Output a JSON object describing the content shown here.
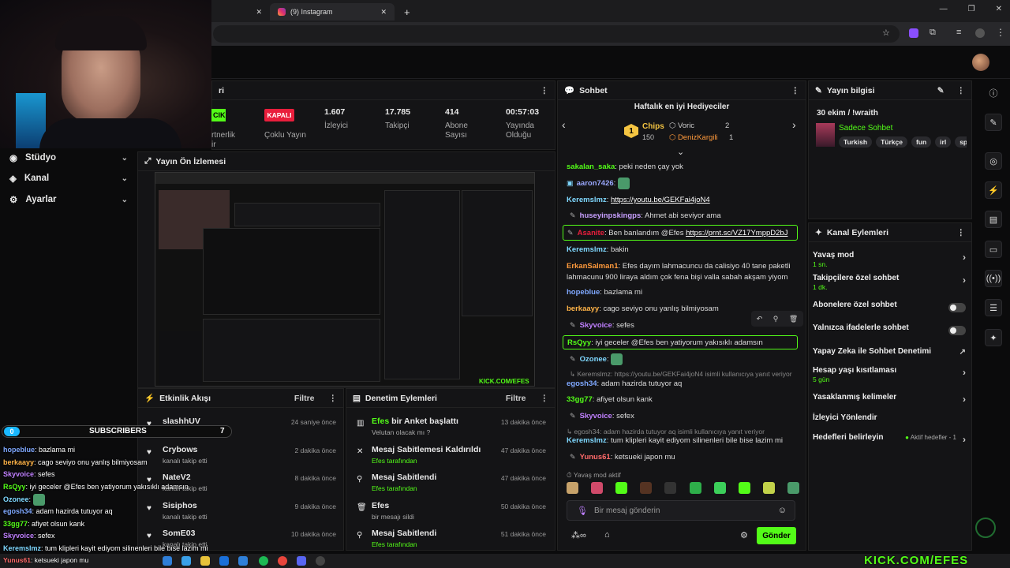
{
  "browser": {
    "tab_instagram": "(9) Instagram",
    "new_tab": "+",
    "window_controls": [
      "—",
      "❐",
      "✕"
    ]
  },
  "colors": {
    "accent": "#53fc18",
    "danger": "#e91e3c",
    "bg": "#0b0b0c",
    "panel": "#141416"
  },
  "nav": {
    "items": [
      {
        "label": "Stüdyo",
        "icon": "studio-icon"
      },
      {
        "label": "Kanal",
        "icon": "channel-icon"
      },
      {
        "label": "Ayarlar",
        "icon": "gear-icon"
      }
    ]
  },
  "stats_panel": {
    "title_tail": "ri",
    "live_badge": "CIK",
    "live_sub": "rtnerlik\nir",
    "offline_badge": "KAPALI",
    "offline_label": "Çoklu Yayın",
    "stats": [
      {
        "value": "1.607",
        "label": "İzleyici"
      },
      {
        "value": "17.785",
        "label": "Takipçi"
      },
      {
        "value": "414",
        "label": "Abone Sayısı"
      },
      {
        "value": "00:57:03",
        "label": "Yayında Olduğu"
      }
    ]
  },
  "preview": {
    "title": "Yayın Ön İzlemesi",
    "watermark": "KICK.COM/EFES"
  },
  "activity": {
    "title": "Etkinlik Akışı",
    "filter": "Filtre",
    "rows": [
      {
        "name": "slashhUV",
        "sub": "kanalı takip etti",
        "time": "24 saniye önce"
      },
      {
        "name": "Crybows",
        "sub": "kanalı takip etti",
        "time": "2 dakika önce"
      },
      {
        "name": "NateV2",
        "sub": "kanalı takip etti",
        "time": "8 dakika önce"
      },
      {
        "name": "Sisiphos",
        "sub": "kanalı takip etti",
        "time": "9 dakika önce"
      },
      {
        "name": "SomE03",
        "sub": "kanalı takip etti",
        "time": "10 dakika önce"
      }
    ]
  },
  "moderation": {
    "title": "Denetim Eylemleri",
    "filter": "Filtre",
    "rows": [
      {
        "name": "Efes",
        "rest": "bir Anket başlattı",
        "sub": "Velutan olacak mı ?",
        "time": "13 dakika önce"
      },
      {
        "name": "Mesaj Sabitlemesi Kaldırıldı",
        "rest": "",
        "sub": "Efes tarafından",
        "time": "47 dakika önce"
      },
      {
        "name": "Mesaj Sabitlendi",
        "rest": "",
        "sub": "Efes tarafından",
        "time": "47 dakika önce"
      },
      {
        "name": "Efes",
        "rest": "",
        "sub": "bir mesajı sildi",
        "time": "50 dakika önce"
      },
      {
        "name": "Mesaj Sabitlendi",
        "rest": "",
        "sub": "Efes tarafından",
        "time": "51 dakika önce"
      }
    ]
  },
  "chat": {
    "title": "Sohbet",
    "gifters_title": "Haftalık en iyi Hediyeciler",
    "gifters": [
      {
        "rank": "1",
        "name": "Chips",
        "amount": "150"
      },
      {
        "name": "Voric",
        "amount": "2"
      },
      {
        "name": "DenizKargili",
        "amount": "1"
      }
    ],
    "messages": [
      {
        "user": "sakalan_saka",
        "text": ": peki neden çay yok",
        "color": "#53fc18"
      },
      {
        "user": "aaron7426",
        "text": ":",
        "color": "#9aa8ff"
      },
      {
        "user": "Keremslmz",
        "text": ": ",
        "link": "https://youtu.be/GEKFai4joN4",
        "color": "#7fd8ff"
      },
      {
        "user": "huseyinpskingps",
        "text": ": Ahmet abi seviyor ama",
        "color": "#c8a0ff"
      },
      {
        "user": "Asanite",
        "text": ": Ben banlandım @Efes ",
        "link": "https://prnt.sc/VZ17YmppD2bJ",
        "color": "#e91e3c"
      },
      {
        "user": "Keremslmz",
        "text": ": bakin",
        "color": "#7fd8ff"
      },
      {
        "user": "ErkanSalman1",
        "text": ": Efes dayım lahmacuncu da calisiyo 40 tane paketli",
        "color": "#ff9a3c"
      },
      {
        "user": "",
        "text": "lahmacunu 900 liraya aldım çok fena bişi valla sabah akşam yiyom",
        "color": "#ddd"
      },
      {
        "user": "hopeblue",
        "text": ": bazlama mi",
        "color": "#7fa8ff"
      },
      {
        "user": "berkaayy",
        "text": ": cago seviyo onu yanlış bilmiyosam",
        "color": "#ffb347"
      },
      {
        "user": "Skyvoice",
        "text": ": sefes",
        "color": "#c080ff"
      },
      {
        "user": "RsQyy",
        "text": ": iyi geceler @Efes ben yatiyorum yakısıklı adamsın",
        "color": "#53fc18"
      },
      {
        "user": "Ozonee",
        "text": ":",
        "color": "#7fd8ff"
      },
      {
        "user": "",
        "text": "Keremslmz: https://youtu.be/GEKFai4joN4 isimli kullanıcıya yanıt veriyor",
        "color": "#888"
      },
      {
        "user": "egosh34",
        "text": ": adam hazirda tutuyor aq",
        "color": "#7fa8ff"
      },
      {
        "user": "33gg77",
        "text": ": afiyet olsun kank",
        "color": "#53fc18"
      },
      {
        "user": "Skyvoice",
        "text": ": sefex",
        "color": "#c080ff"
      },
      {
        "user": "",
        "text": "egosh34: adam hazirda tutuyor aq isimli kullanıcıya yanıt veriyor",
        "color": "#888"
      },
      {
        "user": "Keremslmz",
        "text": ": tum klipleri kayit ediyom silinenleri bile bise lazim mi",
        "color": "#7fd8ff"
      },
      {
        "user": "Yunus61",
        "text": ": ketsueki japon mu",
        "color": "#ff6a6a"
      }
    ],
    "slow_mode": "Yavaş mod aktif",
    "input_placeholder": "Bir mesaj gönderin",
    "send": "Gönder"
  },
  "stream_info": {
    "title": "Yayın bilgisi",
    "stream_title": "30 ekim / !wraith",
    "category": "Sadece Sohbet",
    "tags": [
      "Turkish",
      "Türkçe",
      "fun",
      "irl",
      "spe"
    ]
  },
  "channel_actions": {
    "title": "Kanal Eylemleri",
    "items": [
      {
        "label": "Yavaş mod",
        "sub": "1 sn.",
        "control": "chevron"
      },
      {
        "label": "Takipçilere özel sohbet",
        "sub": "1 dk.",
        "control": "chevron"
      },
      {
        "label": "Abonelere özel sohbet",
        "sub": "",
        "control": "toggle"
      },
      {
        "label": "Yalnızca ifadelerle sohbet",
        "sub": "",
        "control": "toggle"
      },
      {
        "label": "Yapay Zeka ile Sohbet Denetimi",
        "sub": "",
        "control": "external"
      },
      {
        "label": "Hesap yaşı kısıtlaması",
        "sub": "5 gün",
        "control": "chevron"
      },
      {
        "label": "Yasaklanmış kelimeler",
        "sub": "",
        "control": "chevron"
      },
      {
        "label": "İzleyici Yönlendir",
        "sub": "",
        "control": "none"
      },
      {
        "label": "Hedefleri belirleyin",
        "sub": "",
        "control": "goal"
      }
    ],
    "goal_text": "Aktif hedefler - 1"
  },
  "overlay": {
    "subscribers_count": "0",
    "subscribers_label": "SUBSCRIBERS",
    "subscribers_goal": "7",
    "lines": [
      {
        "user": "hopeblue",
        "text": ": bazlama mi"
      },
      {
        "user": "berkaayy",
        "text": ": cago seviyo onu yanlış bilmiyosam"
      },
      {
        "user": "Skyvoice",
        "text": ": sefes"
      },
      {
        "user": "RsQyy",
        "text": ": iyi geceler @Efes ben yatiyorum yakısıklı adamsın"
      },
      {
        "user": "Ozonee",
        "text": ":"
      },
      {
        "user": "egosh34",
        "text": ": adam hazirda tutuyor aq"
      },
      {
        "user": "33gg77",
        "text": ": afiyet olsun kank"
      },
      {
        "user": "Skyvoice",
        "text": ": sefex"
      },
      {
        "user": "Keremslmz",
        "text": ": tum klipleri kayit ediyom silinenleri bile bise lazim mi"
      },
      {
        "user": "Yunus61",
        "text": ": ketsueki japon mu"
      }
    ],
    "brand": "KICK.COM/EFES"
  }
}
